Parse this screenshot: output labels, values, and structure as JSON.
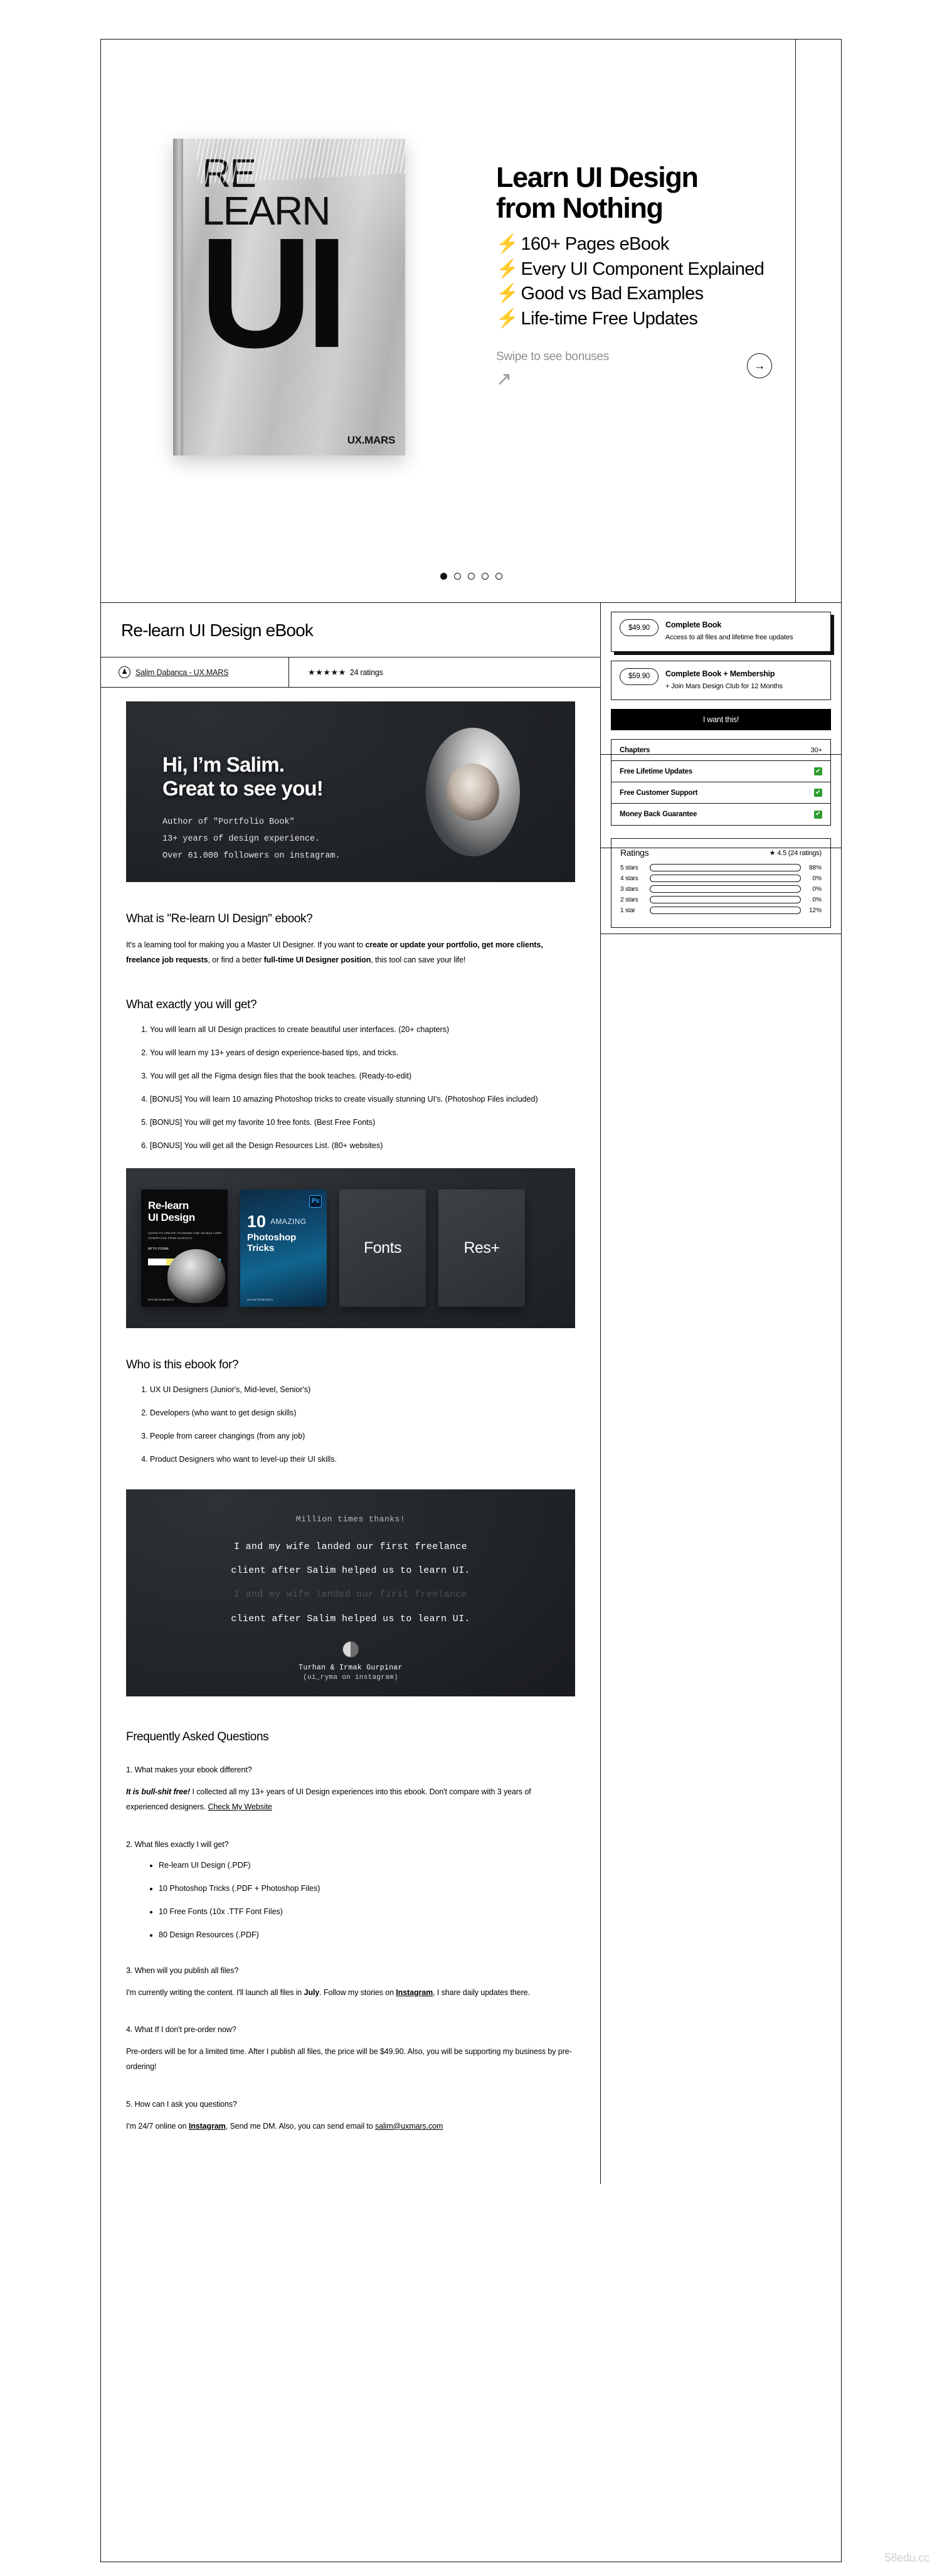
{
  "hero": {
    "book_cover": {
      "title_line1": "RE",
      "title_line2": "LEARN",
      "big_word": "UI",
      "brand": "UX.MARS"
    },
    "headline_line1": "Learn UI Design",
    "headline_line2": "from Nothing",
    "bullets": [
      "160+ Pages eBook",
      "Every UI Component Explained",
      "Good vs Bad Examples",
      "Life-time Free Updates"
    ],
    "bolt_icon": "⚡",
    "swipe_text": "Swipe to see bonuses",
    "swipe_arrow": "↗",
    "next_arrow": "→",
    "dots_total": 5,
    "dots_active_index": 0
  },
  "product": {
    "title": "Re-learn UI Design eBook",
    "author_name": "Salim Dabanca - UX.MARS",
    "author_avatar_glyph": "♟",
    "stars_glyph": "★★★★★",
    "ratings_count_label": "24 ratings"
  },
  "salim_banner": {
    "heading_line1": "Hi, I’m Salim.",
    "heading_line2": "Great to see you!",
    "sub_line1": "Author of \"Portfolio Book\"",
    "sub_line2": "13+ years of design experience.",
    "sub_line3": "Over 61.000 followers on instagram."
  },
  "sections": {
    "what_is": {
      "heading": "What is \"Re-learn UI Design\" ebook?",
      "paragraph_plain_1": "It's a learning tool for making you a Master UI Designer. If you want to ",
      "paragraph_bold_1": "create or update your portfolio, get more clients, freelance job requests",
      "paragraph_plain_2": ", or find a better ",
      "paragraph_bold_2": "full-time UI Designer position",
      "paragraph_plain_3": ", this tool can save your life!"
    },
    "what_get": {
      "heading": "What exactly you will get?",
      "items": [
        "You will learn all UI Design practices to create beautiful user interfaces. (20+ chapters)",
        "You will learn my 13+ years of design experience-based tips, and tricks.",
        "You will get all the Figma design files that the book teaches. (Ready-to-edit)",
        "[BONUS] You will learn 10 amazing Photoshop tricks to create visually stunning UI's. (Photoshop Files included)",
        "[BONUS] You will get my favorite 10 free fonts. (Best Free Fonts)",
        "[BONUS] You will get all the Design Resources List. (80+ websites)"
      ]
    },
    "who_for": {
      "heading": "Who is this ebook for?",
      "items": [
        "UX UI Designers (Junior's, Mid-level, Senior's)",
        "Developers (who want to get design skills)",
        "People from career changings (from any job)",
        "Product Designers who want to level-up their UI skills."
      ]
    }
  },
  "product_grid": {
    "card1": {
      "title_line1": "Re-learn",
      "title_line2": "UI Design",
      "subtitle": "LEARN TO CREATE STUNNING AND USABLE USER INTERFACES FROM SCRATCH",
      "figma_label": "WITH FIGMA",
      "author": "SALIM DABANCA"
    },
    "card2": {
      "ps_badge": "Ps",
      "number": "10",
      "amazing": "AMAZING",
      "title_line1": "Photoshop",
      "title_line2": "Tricks",
      "author": "SALIM DABANCA"
    },
    "card3_label": "Fonts",
    "card4_label": "Res+"
  },
  "testimonial": {
    "kicker": "Million times thanks!",
    "line1": "I and my wife landed our first freelance",
    "line2": "client after Salim helped us to learn UI.",
    "line3_ghost": "I and my wife landed our first freelance",
    "line4": "client after Salim helped us to learn UI.",
    "name": "Turhan & Irmak Gurpinar",
    "handle": "(ui_ryma on instagram)"
  },
  "faq": {
    "heading": "Frequently Asked Questions",
    "items": [
      {
        "question": "1. What makes your ebook different?",
        "answer_bold": "It is bull-shit free!",
        "answer_plain": " I collected all my 13+ years of UI Design experiences into this ebook. Don't compare with 3 years of experienced designers. ",
        "answer_link": "Check My Website",
        "answer_tail": ""
      },
      {
        "question": "2. What files exactly I will get?",
        "bullets": [
          "Re-learn UI Design (.PDF)",
          "10 Photoshop Tricks (.PDF + Photoshop Files)",
          "10 Free Fonts (10x .TTF Font Files)",
          "80 Design Resources (.PDF)"
        ]
      },
      {
        "question": "3. When will you publish all files?",
        "answer_p1": "I'm currently writing the content. I'll launch all files in ",
        "answer_b1": "July",
        "answer_p2": ". Follow my stories on ",
        "answer_link": "Instagram",
        "answer_p3": ", I share daily updates there."
      },
      {
        "question": "4. What If I don't pre-order now?",
        "answer": "Pre-orders will be for a limited time. After I publish all files, the price will be $49.90. Also, you will be supporting my business by pre-ordering!"
      },
      {
        "question": "5. How can I ask you questions?",
        "answer_p1": "I'm 24/7 online on ",
        "answer_link1": "Instagram",
        "answer_p2": ", Send me DM. Also, you can send email to ",
        "answer_link2": "salim@uxmars.com"
      }
    ]
  },
  "purchase": {
    "tiers": [
      {
        "price": "$49.90",
        "name": "Complete Book",
        "desc": "Access to all files and lifetime free updates",
        "selected": true
      },
      {
        "price": "$59.90",
        "name": "Complete Book + Membership",
        "desc": "+ Join Mars Design Club for 12 Months",
        "selected": false
      }
    ],
    "buy_label": "I want this!",
    "features": [
      {
        "label": "Chapters",
        "value": "30+",
        "check": false
      },
      {
        "label": "Free Lifetime Updates",
        "value": "",
        "check": true
      },
      {
        "label": "Free Customer Support",
        "value": "",
        "check": true
      },
      {
        "label": "Money Back Guarantee",
        "value": "",
        "check": true
      }
    ],
    "check_glyph": "✔"
  },
  "ratings_panel": {
    "title": "Ratings",
    "star_glyph": "★",
    "average_label": "4.5 (24 ratings)",
    "rows": [
      {
        "label": "5 stars",
        "pct": "88%",
        "value": 88
      },
      {
        "label": "4 stars",
        "pct": "0%",
        "value": 0
      },
      {
        "label": "3 stars",
        "pct": "0%",
        "value": 0
      },
      {
        "label": "2 stars",
        "pct": "0%",
        "value": 0
      },
      {
        "label": "1 star",
        "pct": "12%",
        "value": 12
      }
    ],
    "bar_color": "#f79ef0"
  },
  "watermark": "58edu.cc"
}
